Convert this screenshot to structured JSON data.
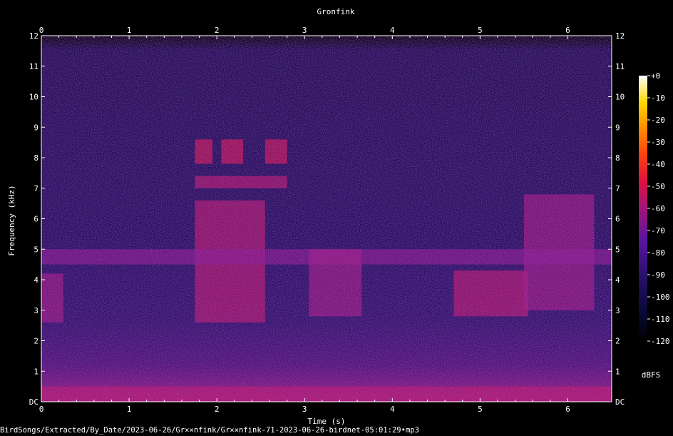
{
  "chart_data": {
    "type": "heatmap",
    "title": "Gronfink",
    "xlabel": "Time (s)",
    "ylabel": "Frequency (kHz)",
    "xlim": [
      0,
      6.5
    ],
    "ylim": [
      0,
      12
    ],
    "x_ticks": [
      "0",
      "1",
      "2",
      "3",
      "4",
      "5",
      "6"
    ],
    "y_ticks": [
      "DC",
      "1",
      "2",
      "3",
      "4",
      "5",
      "6",
      "7",
      "8",
      "9",
      "10",
      "11",
      "12"
    ],
    "colorbar": {
      "label": "dBFS",
      "range": [
        -120,
        0
      ],
      "ticks": [
        "+0",
        "-10",
        "-20",
        "-30",
        "-40",
        "-50",
        "-60",
        "-70",
        "-80",
        "-90",
        "-100",
        "-110",
        "-120"
      ]
    },
    "regions": [
      {
        "t0": 1.75,
        "t1": 2.55,
        "f0": 2.6,
        "f1": 6.6,
        "db": -55
      },
      {
        "t0": 1.75,
        "t1": 1.95,
        "f0": 7.8,
        "f1": 8.6,
        "db": -50
      },
      {
        "t0": 2.05,
        "t1": 2.3,
        "f0": 7.8,
        "f1": 8.6,
        "db": -50
      },
      {
        "t0": 2.55,
        "t1": 2.8,
        "f0": 7.8,
        "f1": 8.6,
        "db": -50
      },
      {
        "t0": 1.75,
        "t1": 2.8,
        "f0": 7.0,
        "f1": 7.4,
        "db": -55
      },
      {
        "t0": 4.7,
        "t1": 5.55,
        "f0": 2.8,
        "f1": 4.3,
        "db": -55
      },
      {
        "t0": 5.5,
        "t1": 6.3,
        "f0": 3.0,
        "f1": 6.8,
        "db": -60
      },
      {
        "t0": 0.0,
        "t1": 6.5,
        "f0": 4.5,
        "f1": 5.0,
        "db": -65
      },
      {
        "t0": 0.0,
        "t1": 0.25,
        "f0": 2.6,
        "f1": 4.2,
        "db": -60
      },
      {
        "t0": 3.05,
        "t1": 3.65,
        "f0": 2.8,
        "f1": 5.0,
        "db": -60
      },
      {
        "t0": 0.0,
        "t1": 6.5,
        "f0": 0.0,
        "f1": 0.5,
        "db": -55
      }
    ],
    "source_file": "BirdSongs/Extracted/By_Date/2023-06-26/Gr××nfink/Gr××nfink-71-2023-06-26-birdnet-05:01:29•mp3"
  }
}
